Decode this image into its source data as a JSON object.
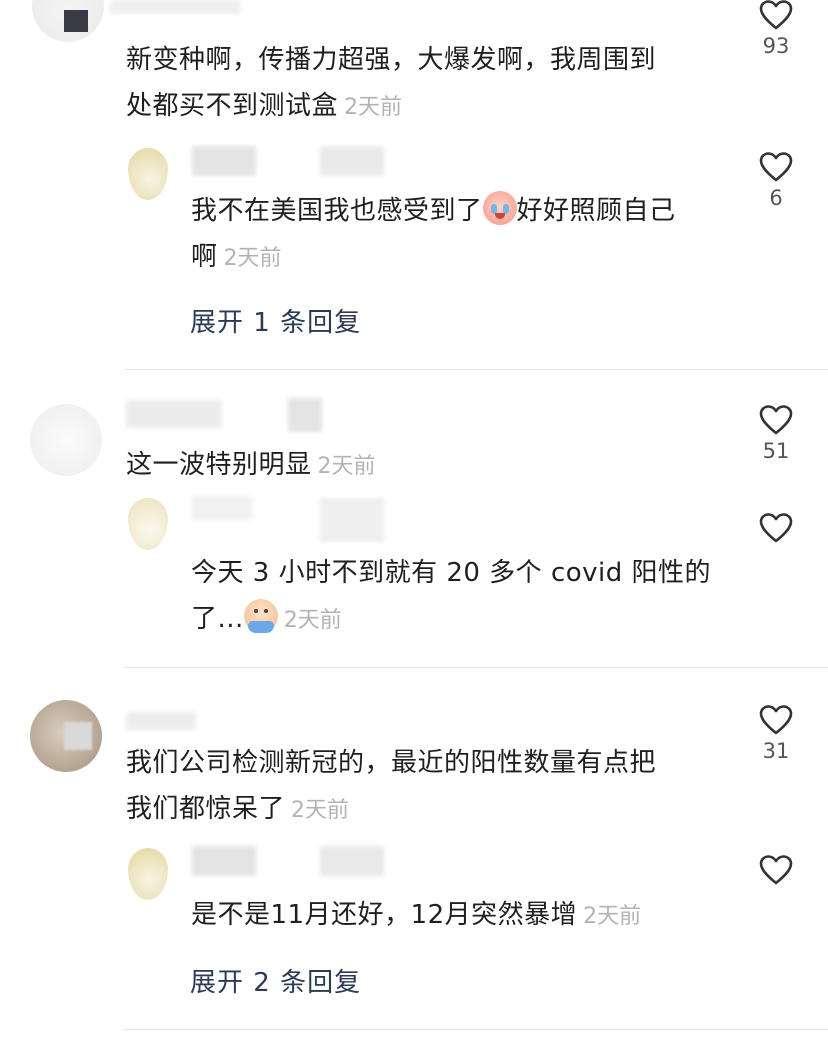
{
  "comments": [
    {
      "text_lines": [
        "新变种啊，传播力超强，大爆发啊，我周围到",
        "处都买不到测试盒"
      ],
      "time": "2天前",
      "likes": "93"
    },
    {
      "text_lines": [
        "我不在美国我也感受到了",
        "好好照顾自己",
        "啊"
      ],
      "time": "2天前",
      "likes": "6",
      "expand": "展开 1 条回复"
    },
    {
      "text_lines": [
        "这一波特别明显"
      ],
      "time": "2天前",
      "likes": "51"
    },
    {
      "text_lines": [
        "今天 3 小时不到就有 20 多个 covid 阳性的",
        "了..."
      ],
      "time": "2天前",
      "likes": ""
    },
    {
      "text_lines": [
        "我们公司检测新冠的，最近的阳性数量有点把",
        "我们都惊呆了"
      ],
      "time": "2天前",
      "likes": "31"
    },
    {
      "text_lines": [
        "是不是11月还好，12月突然暴增"
      ],
      "time": "2天前",
      "likes": "",
      "expand": "展开 2 条回复"
    }
  ],
  "icons": {
    "like": "heart-outline-icon",
    "emoji_cry": "crying-face-emoji",
    "emoji_scared": "scared-face-emoji"
  },
  "colors": {
    "text": "#1f1f1f",
    "time": "#b3b3b3",
    "expand": "#2b3a55",
    "divider": "#e6e6e6"
  }
}
